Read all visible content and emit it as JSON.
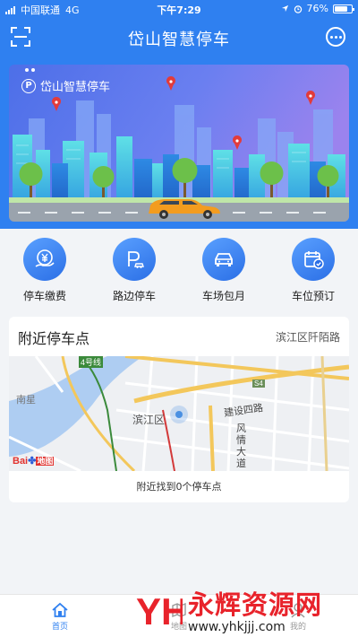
{
  "status_bar": {
    "carrier": "中国联通",
    "network": "4G",
    "time": "下午7:29",
    "battery": "76%",
    "battery_level": 0.76
  },
  "navbar": {
    "title": "岱山智慧停车"
  },
  "banner": {
    "logo_text": "岱山智慧停车",
    "logo_mark": "P"
  },
  "quick_actions": [
    {
      "label": "停车缴费",
      "icon": "yuan-payment-icon"
    },
    {
      "label": "路边停车",
      "icon": "roadside-parking-icon"
    },
    {
      "label": "车场包月",
      "icon": "car-icon"
    },
    {
      "label": "车位预订",
      "icon": "calendar-check-icon"
    }
  ],
  "nearby": {
    "title": "附近停车点",
    "location": "滨江区阡陌路",
    "footer": "附近找到0个停车点",
    "map_labels": {
      "district": "滨江区",
      "road1": "建设四路",
      "road2": "风情大道",
      "west": "南星",
      "metro": "4号线",
      "highway": "S4",
      "baidu": "Bai",
      "baidu_cn": "地图"
    }
  },
  "tabbar": {
    "home": "首页",
    "map": "地图",
    "mine": "我的"
  },
  "watermark": {
    "title": "永辉资源网",
    "url": "www.yhkjjj.com",
    "logo_letters": "YH"
  },
  "colors": {
    "primary": "#2f80f0",
    "watermark_red": "#e8232b"
  }
}
